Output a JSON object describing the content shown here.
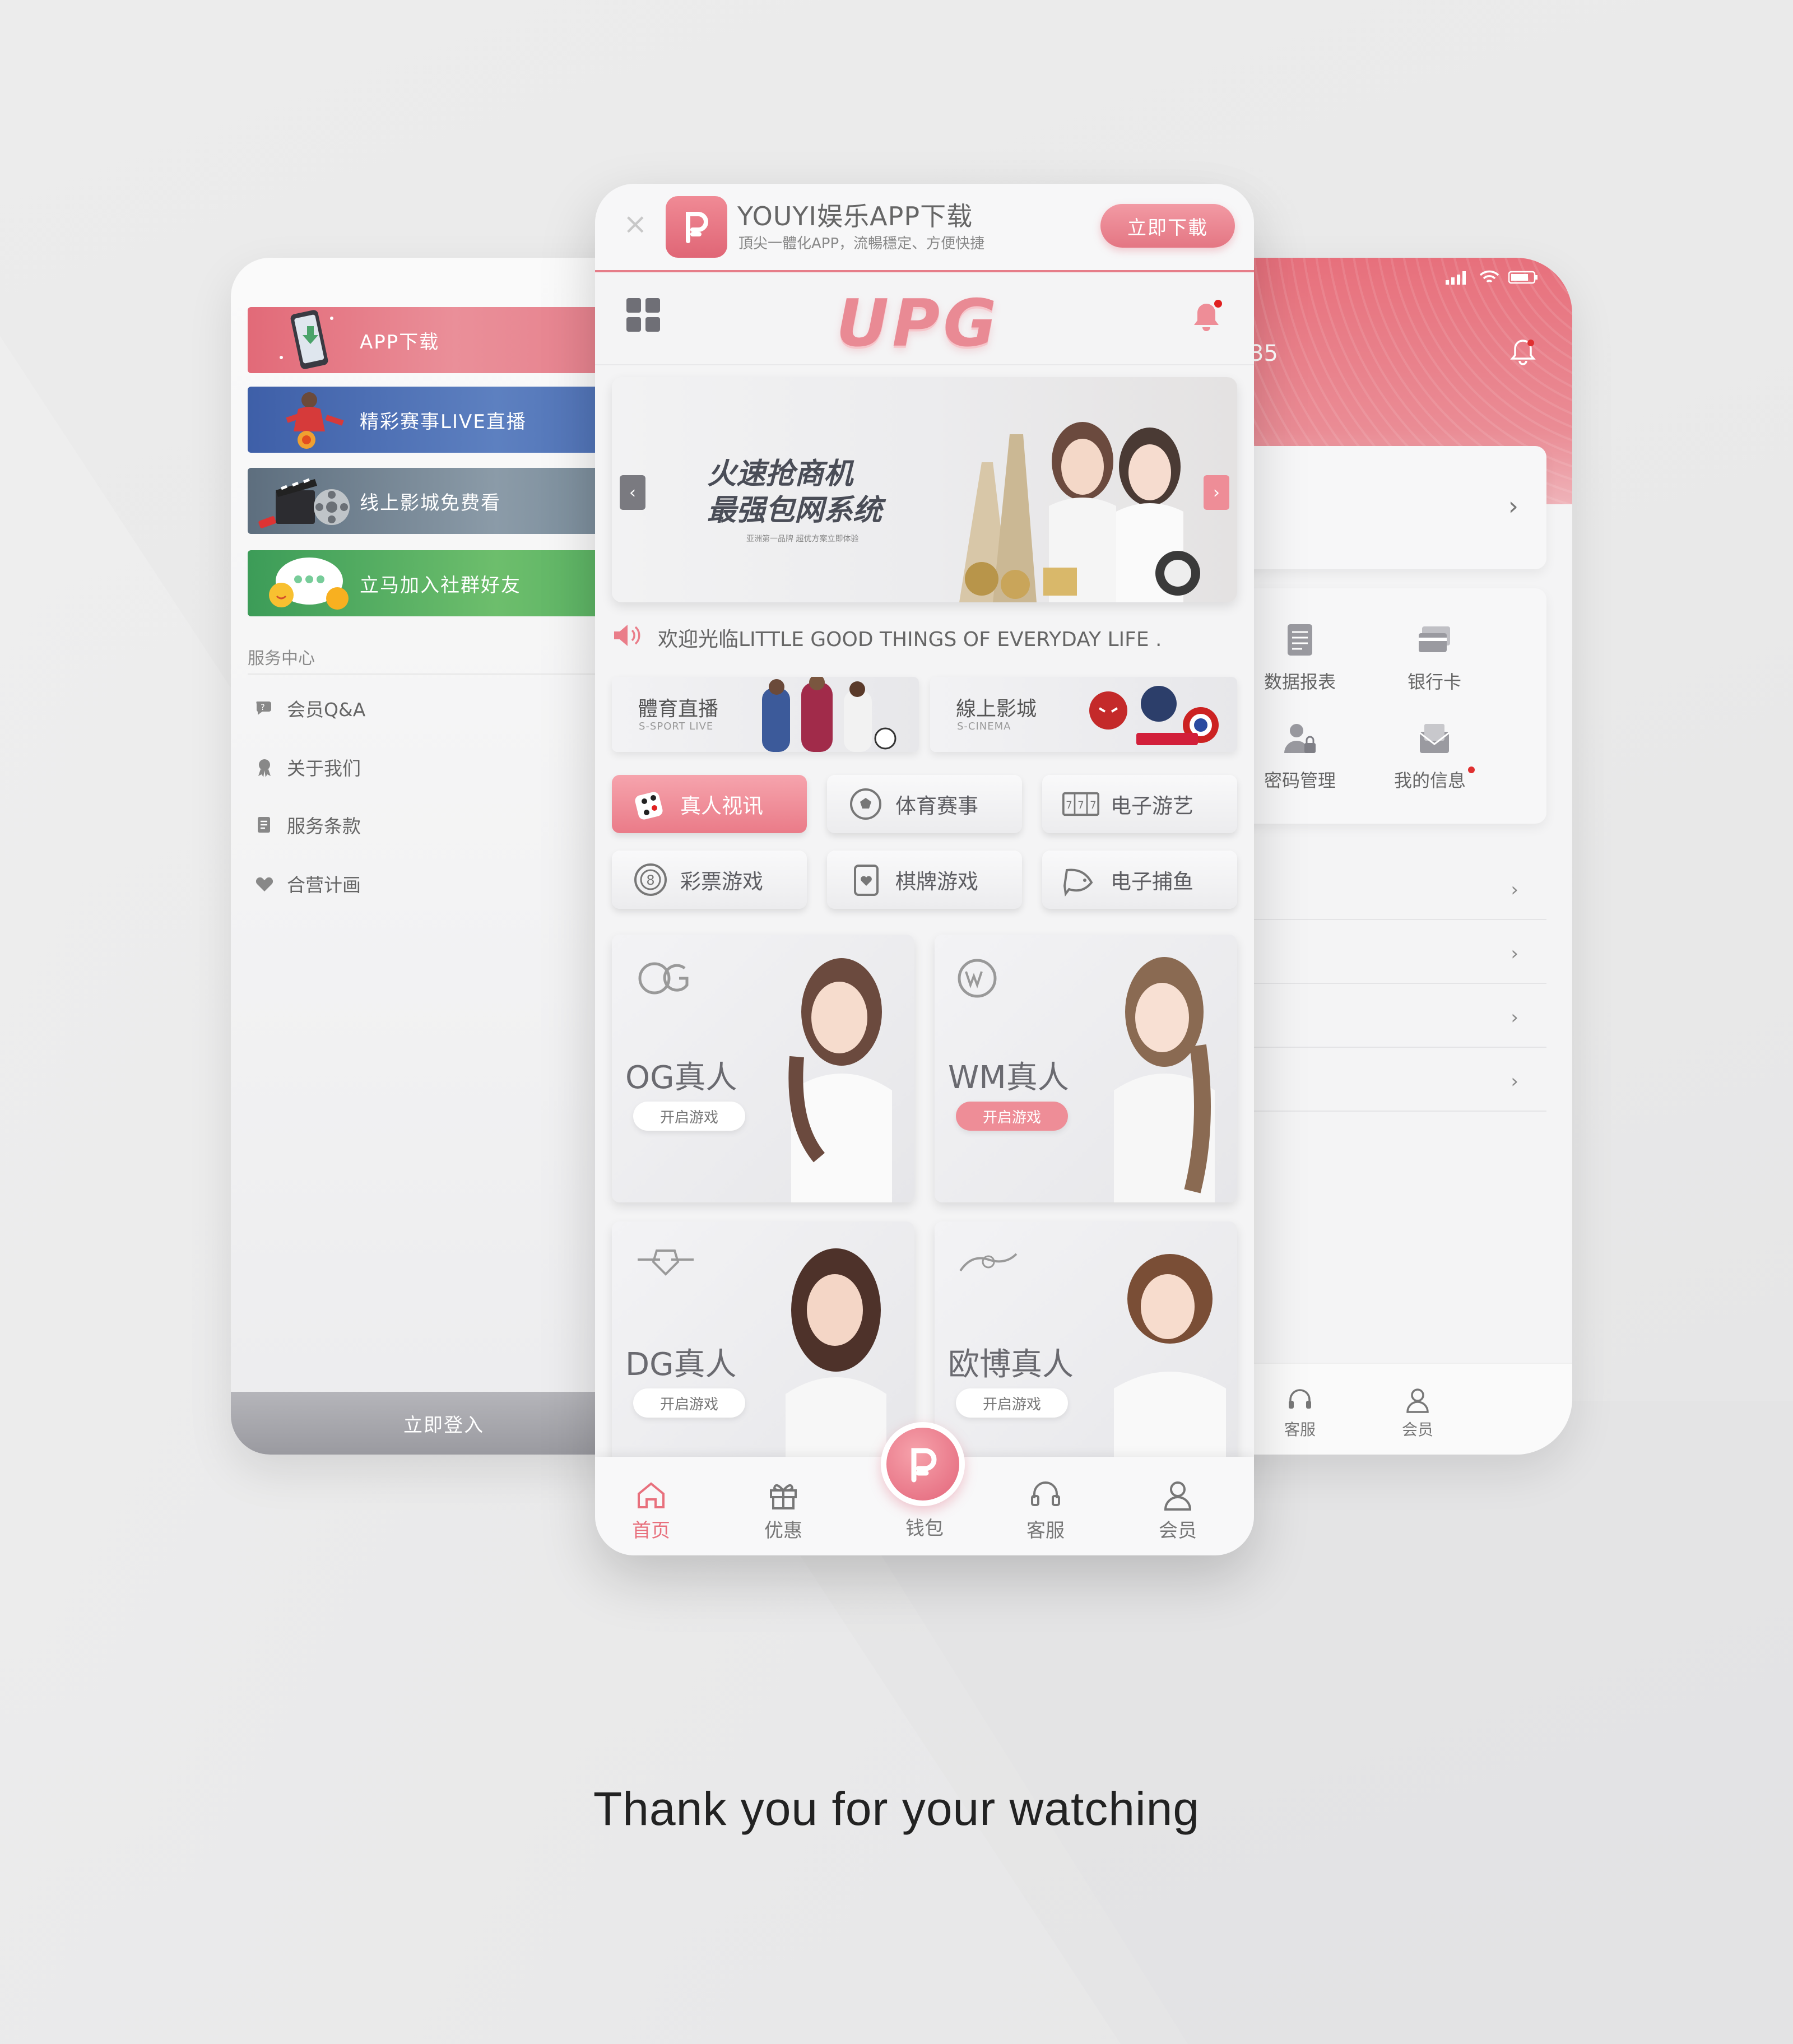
{
  "left_menu": {
    "promos": [
      {
        "label": "APP下载"
      },
      {
        "label": "精彩赛事LIVE直播"
      },
      {
        "label": "线上影城免费看"
      },
      {
        "label": "立马加入社群好友"
      }
    ],
    "service_title": "服务中心",
    "service_items": [
      {
        "label": "会员Q&A",
        "icon": "chat-question-icon"
      },
      {
        "label": "关于我们",
        "icon": "award-icon"
      },
      {
        "label": "服务条款",
        "icon": "document-icon"
      },
      {
        "label": "合营计画",
        "icon": "handshake-heart-icon"
      }
    ],
    "login_label": "立即登入"
  },
  "right_member": {
    "partial_number": "35",
    "tiles": [
      {
        "label": "数据报表",
        "icon": "report-icon"
      },
      {
        "label": "银行卡",
        "icon": "bank-card-icon"
      },
      {
        "label": "密码管理",
        "icon": "user-lock-icon"
      },
      {
        "label": "我的信息",
        "icon": "mail-icon"
      }
    ],
    "nav": [
      {
        "label": "钱包"
      },
      {
        "label": "客服"
      },
      {
        "label": "会员"
      }
    ]
  },
  "download_bar": {
    "title": "YOUYI娱乐APP下载",
    "subtitle": "頂尖一體化APP，流暢穩定、方便快捷",
    "button": "立即下載"
  },
  "header": {
    "logo": "UPG"
  },
  "banner": {
    "line1": "火速抢商机",
    "line2": "最强包网系统",
    "line3": "亚洲第一品牌  超优方案立即体验"
  },
  "marquee": {
    "text": "欢迎光临LITTLE GOOD THINGS OF EVERYDAY LIFE ."
  },
  "features": [
    {
      "title": "體育直播",
      "subtitle": "S-SPORT LIVE"
    },
    {
      "title": "線上影城",
      "subtitle": "S-CINEMA"
    }
  ],
  "categories": [
    {
      "label": "真人视讯",
      "active": true
    },
    {
      "label": "体育赛事",
      "active": false
    },
    {
      "label": "电子游艺",
      "active": false
    },
    {
      "label": "彩票游戏",
      "active": false
    },
    {
      "label": "棋牌游戏",
      "active": false
    },
    {
      "label": "电子捕鱼",
      "active": false
    }
  ],
  "games": [
    {
      "title": "OG真人",
      "button": "开启游戏"
    },
    {
      "title": "WM真人",
      "button": "开启游戏"
    },
    {
      "title": "DG真人",
      "button": "开启游戏"
    },
    {
      "title": "欧博真人",
      "button": "开启游戏"
    }
  ],
  "tabbar": [
    {
      "label": "首页",
      "active": true
    },
    {
      "label": "优惠",
      "active": false
    },
    {
      "label": "钱包",
      "active": false
    },
    {
      "label": "客服",
      "active": false
    },
    {
      "label": "会员",
      "active": false
    }
  ],
  "colors": {
    "accent": "#e8707d",
    "accent_light": "#f29aa4"
  },
  "footer": {
    "thanks": "Thank you for your watching"
  }
}
